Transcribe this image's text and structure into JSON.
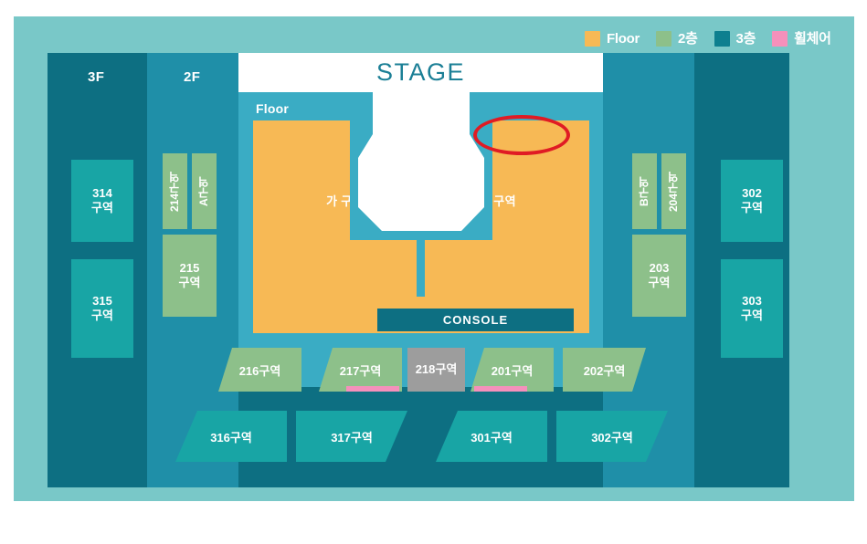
{
  "legend": {
    "items": [
      {
        "label": "Floor",
        "color": "#f7b955",
        "name": "legend-floor"
      },
      {
        "label": "2층",
        "color": "#8dc08a",
        "name": "legend-2f"
      },
      {
        "label": "3층",
        "color": "#0d7f8f",
        "name": "legend-3f"
      },
      {
        "label": "휠체어",
        "color": "#f590bb",
        "name": "legend-wheelchair"
      }
    ]
  },
  "hall": {
    "floor_labels": {
      "left": "3F",
      "middle": "2F"
    },
    "stage": "STAGE",
    "floor_tag": "Floor",
    "console": "CONSOLE",
    "floor_blocks": [
      {
        "label": "가 구역"
      },
      {
        "label": "나 구역"
      }
    ],
    "left_3f_blocks": [
      {
        "label": "314\n구역"
      },
      {
        "label": "315\n구역"
      }
    ],
    "right_3f_blocks": [
      {
        "label": "302\n구역"
      },
      {
        "label": "303\n구역"
      }
    ],
    "left_2f_vertical": [
      {
        "label": "214구역"
      },
      {
        "label": "A구역"
      }
    ],
    "right_2f_vertical": [
      {
        "label": "B구역"
      },
      {
        "label": "204구역"
      }
    ],
    "left_2f_block": {
      "label": "215\n구역"
    },
    "right_2f_block": {
      "label": "203\n구역"
    },
    "row_2f": [
      {
        "label": "216구역",
        "wheelchair": false
      },
      {
        "label": "217구역",
        "wheelchair": true
      },
      {
        "label": "218구역",
        "wheelchair": false
      },
      {
        "label": "201구역",
        "wheelchair": true
      },
      {
        "label": "202구역",
        "wheelchair": false
      }
    ],
    "row_3f": [
      {
        "label": "316구역"
      },
      {
        "label": "317구역"
      },
      {
        "label": "301구역"
      },
      {
        "label": "302구역"
      }
    ]
  },
  "annotation": {
    "shape": "ellipse",
    "color": "#e01b24",
    "target": "나 구역"
  }
}
